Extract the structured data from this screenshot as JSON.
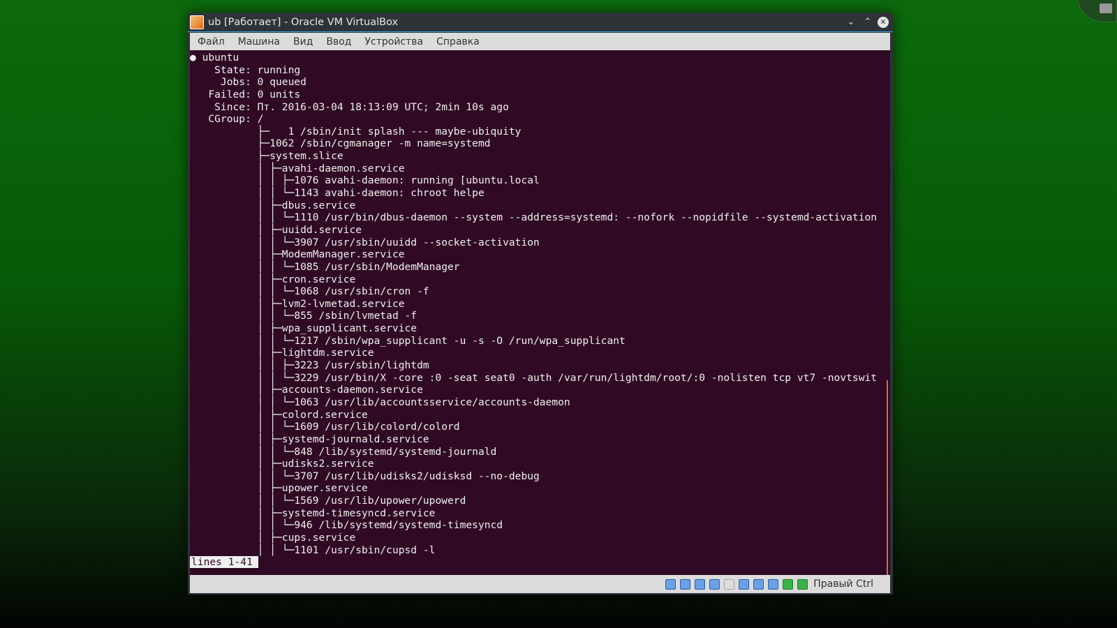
{
  "window": {
    "title": "ub [Работает] - Oracle VM VirtualBox"
  },
  "menu": [
    "Файл",
    "Машина",
    "Вид",
    "Ввод",
    "Устройства",
    "Справка"
  ],
  "terminal": {
    "lines": [
      "● ubuntu",
      "    State: running",
      "     Jobs: 0 queued",
      "   Failed: 0 units",
      "    Since: Пт. 2016-03-04 18:13:09 UTC; 2min 10s ago",
      "   CGroup: /",
      "           ├─   1 /sbin/init splash --- maybe-ubiquity",
      "           ├─1062 /sbin/cgmanager -m name=systemd",
      "           ├─system.slice",
      "           │ ├─avahi-daemon.service",
      "           │ │ ├─1076 avahi-daemon: running [ubuntu.local",
      "           │ │ └─1143 avahi-daemon: chroot helpe",
      "           │ ├─dbus.service",
      "           │ │ └─1110 /usr/bin/dbus-daemon --system --address=systemd: --nofork --nopidfile --systemd-activation",
      "           │ ├─uuidd.service",
      "           │ │ └─3907 /usr/sbin/uuidd --socket-activation",
      "           │ ├─ModemManager.service",
      "           │ │ └─1085 /usr/sbin/ModemManager",
      "           │ ├─cron.service",
      "           │ │ └─1068 /usr/sbin/cron -f",
      "           │ ├─lvm2-lvmetad.service",
      "           │ │ └─855 /sbin/lvmetad -f",
      "           │ ├─wpa_supplicant.service",
      "           │ │ └─1217 /sbin/wpa_supplicant -u -s -O /run/wpa_supplicant",
      "           │ ├─lightdm.service",
      "           │ │ ├─3223 /usr/sbin/lightdm",
      "           │ │ └─3229 /usr/bin/X -core :0 -seat seat0 -auth /var/run/lightdm/root/:0 -nolisten tcp vt7 -novtswit",
      "           │ ├─accounts-daemon.service",
      "           │ │ └─1063 /usr/lib/accountsservice/accounts-daemon",
      "           │ ├─colord.service",
      "           │ │ └─1609 /usr/lib/colord/colord",
      "           │ ├─systemd-journald.service",
      "           │ │ └─848 /lib/systemd/systemd-journald",
      "           │ ├─udisks2.service",
      "           │ │ └─3707 /usr/lib/udisks2/udisksd --no-debug",
      "           │ ├─upower.service",
      "           │ │ └─1569 /usr/lib/upower/upowerd",
      "           │ ├─systemd-timesyncd.service",
      "           │ │ └─946 /lib/systemd/systemd-timesyncd",
      "           │ ├─cups.service",
      "           │ │ └─1101 /usr/sbin/cupsd -l"
    ],
    "pager_status": "lines 1-41"
  },
  "statusbar": {
    "host_key": "Правый Ctrl",
    "icons": [
      "hard-disk-icon",
      "optical-disk-icon",
      "usb-icon",
      "shared-folder-icon",
      "display-icon",
      "network-icon",
      "video-capture-icon",
      "cpu-icon",
      "mouse-integration-icon",
      "download-icon"
    ]
  },
  "colors": {
    "terminal_bg": "#300a24",
    "desktop": "#075a07",
    "accent": "#3daee9"
  }
}
